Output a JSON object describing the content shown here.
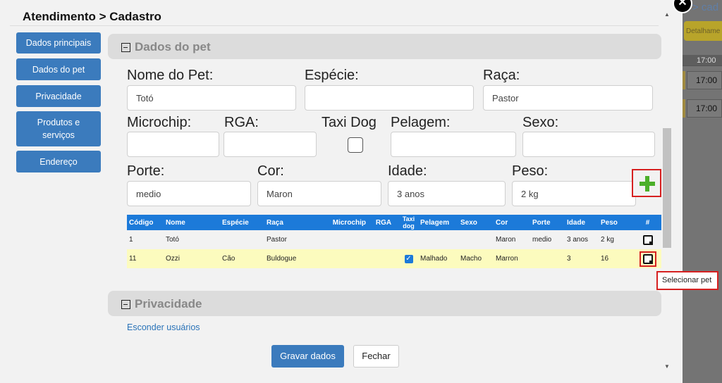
{
  "background": {
    "title_fragment": "> cad",
    "button_fragment": "Detalhame",
    "times": [
      "17:00",
      "17:00",
      "17:00"
    ]
  },
  "close_button": "✕",
  "modal": {
    "title": "Atendimento > Cadastro",
    "sidebar": [
      {
        "label": "Dados principais"
      },
      {
        "label": "Dados do pet"
      },
      {
        "label": "Privacidade"
      },
      {
        "label": "Produtos e serviços"
      },
      {
        "label": "Endereço"
      }
    ]
  },
  "pet_section": {
    "title": "Dados do pet",
    "fields": {
      "nome": {
        "label": "Nome do Pet:",
        "value": "Totó"
      },
      "especie": {
        "label": "Espécie:",
        "value": ""
      },
      "raca": {
        "label": "Raça:",
        "value": "Pastor"
      },
      "microchip": {
        "label": "Microchip:",
        "value": ""
      },
      "rga": {
        "label": "RGA:",
        "value": ""
      },
      "taxi_dog": {
        "label": "Taxi Dog",
        "checked": false
      },
      "pelagem": {
        "label": "Pelagem:",
        "value": ""
      },
      "sexo": {
        "label": "Sexo:",
        "value": ""
      },
      "porte": {
        "label": "Porte:",
        "value": "medio"
      },
      "cor": {
        "label": "Cor:",
        "value": "Maron"
      },
      "idade": {
        "label": "Idade:",
        "value": "3 anos"
      },
      "peso": {
        "label": "Peso:",
        "value": "2 kg"
      }
    },
    "add_icon": "plus-icon",
    "table": {
      "headers": [
        "Código",
        "Nome",
        "Espécie",
        "Raça",
        "Microchip",
        "RGA",
        "Taxi dog",
        "Pelagem",
        "Sexo",
        "Cor",
        "Porte",
        "Idade",
        "Peso",
        "#"
      ],
      "rows": [
        {
          "codigo": "1",
          "nome": "Totó",
          "especie": "",
          "raca": "Pastor",
          "microchip": "",
          "rga": "",
          "taxi": false,
          "pelagem": "",
          "sexo": "",
          "cor": "Maron",
          "porte": "medio",
          "idade": "3 anos",
          "peso": "2 kg"
        },
        {
          "codigo": "11",
          "nome": "Ozzi",
          "especie": "Cão",
          "raca": "Buldogue",
          "microchip": "",
          "rga": "",
          "taxi": true,
          "pelagem": "Malhado",
          "sexo": "Macho",
          "cor": "Marron",
          "porte": "",
          "idade": "3",
          "peso": "16"
        }
      ]
    },
    "tooltip": "Selecionar pet"
  },
  "privacy_section": {
    "title": "Privacidade",
    "link": "Esconder usuários"
  },
  "actions": {
    "save": "Gravar dados",
    "close": "Fechar"
  },
  "colors": {
    "primary": "#3b7bbd",
    "table_header": "#1c7ad9",
    "highlight_row": "#fcfbbe",
    "annotation_red": "#d62020",
    "add_green": "#4caf2a"
  }
}
